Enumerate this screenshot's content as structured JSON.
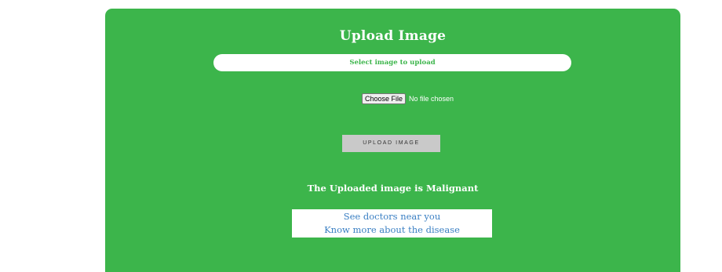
{
  "panel": {
    "background_color": "#3cb54b",
    "title": "Upload Image",
    "select_label": "Select image to upload",
    "file_input": {
      "button_label": "Choose File",
      "status_text": "No file chosen"
    },
    "upload_button_label": "UPLOAD IMAGE",
    "result_text": "The Uploaded image is Malignant",
    "links": {
      "doctors": "See doctors near you",
      "disease": "Know more about the disease",
      "link_color": "#3a7fc3"
    }
  }
}
